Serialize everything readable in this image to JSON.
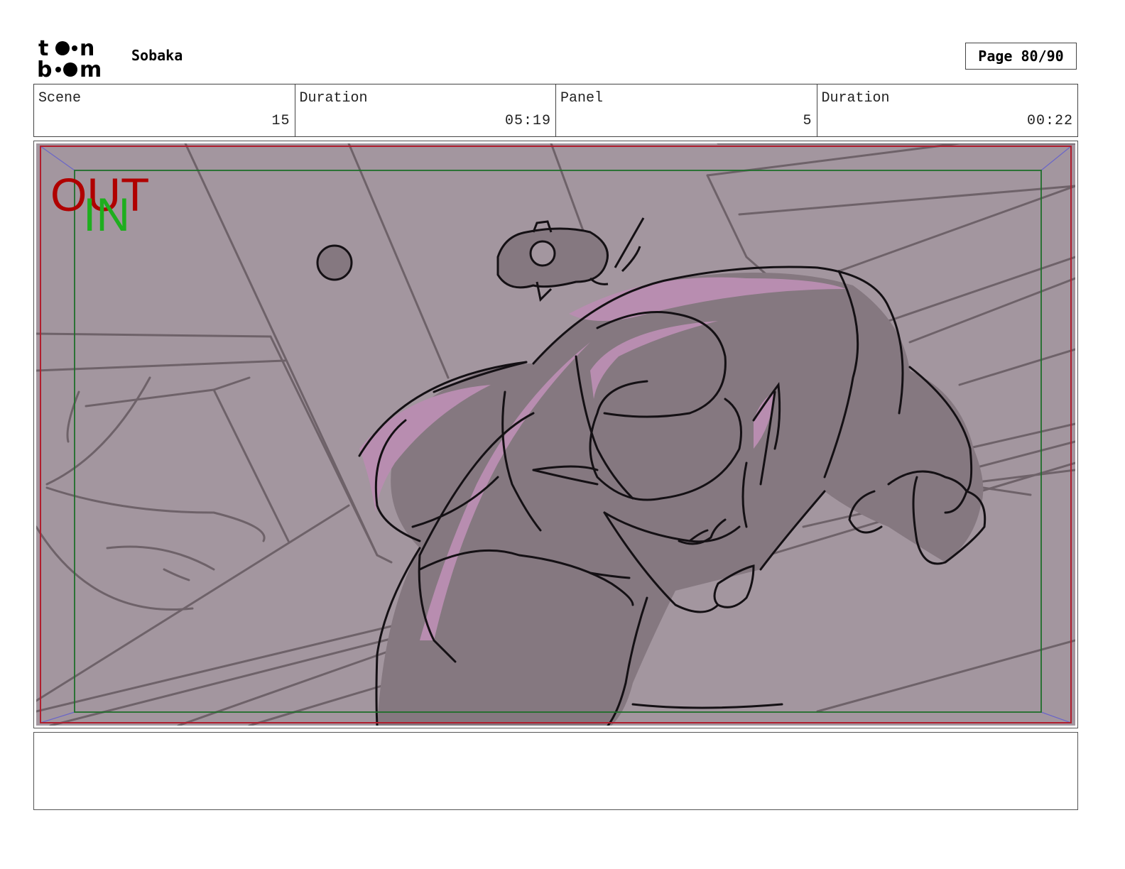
{
  "header": {
    "logo_name": "toon boom",
    "project_title": "Sobaka",
    "page_label": "Page 80/90"
  },
  "info": {
    "scene_label": "Scene",
    "scene_value": "15",
    "scene_duration_label": "Duration",
    "scene_duration_value": "05:19",
    "panel_label": "Panel",
    "panel_value": "5",
    "panel_duration_label": "Duration",
    "panel_duration_value": "00:22"
  },
  "frame_markers": {
    "out_label": "OUT",
    "in_label": "IN"
  },
  "notes": {
    "text": ""
  },
  "colors": {
    "out_frame": "#b01e2e",
    "in_frame": "#1e6e2a",
    "out_text": "#b00000",
    "in_text": "#1fae1f",
    "background_fill": "#a3969f",
    "character_fill": "#857880",
    "highlight": "#b88db0"
  }
}
